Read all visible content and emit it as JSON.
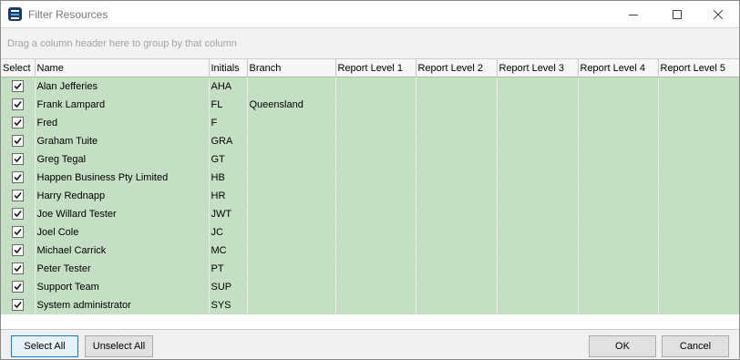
{
  "window": {
    "title": "Filter Resources",
    "icon": "app-logo-icon"
  },
  "group_panel": {
    "hint": "Drag a column header here to group by that column"
  },
  "grid": {
    "columns": [
      "Select",
      "Name",
      "Initials",
      "Branch",
      "Report Level 1",
      "Report Level 2",
      "Report Level 3",
      "Report Level 4",
      "Report Level 5"
    ],
    "rows": [
      {
        "selected": true,
        "name": "Alan Jefferies",
        "initials": "AHA",
        "branch": ""
      },
      {
        "selected": true,
        "name": "Frank Lampard",
        "initials": "FL",
        "branch": "Queensland"
      },
      {
        "selected": true,
        "name": "Fred",
        "initials": "F",
        "branch": ""
      },
      {
        "selected": true,
        "name": "Graham Tuite",
        "initials": "GRA",
        "branch": ""
      },
      {
        "selected": true,
        "name": "Greg Tegal",
        "initials": "GT",
        "branch": ""
      },
      {
        "selected": true,
        "name": "Happen Business Pty Limited",
        "initials": "HB",
        "branch": ""
      },
      {
        "selected": true,
        "name": "Harry Rednapp",
        "initials": "HR",
        "branch": ""
      },
      {
        "selected": true,
        "name": "Joe Willard Tester",
        "initials": "JWT",
        "branch": ""
      },
      {
        "selected": true,
        "name": "Joel Cole",
        "initials": "JC",
        "branch": ""
      },
      {
        "selected": true,
        "name": "Michael Carrick",
        "initials": "MC",
        "branch": ""
      },
      {
        "selected": true,
        "name": "Peter Tester",
        "initials": "PT",
        "branch": ""
      },
      {
        "selected": true,
        "name": "Support Team",
        "initials": "SUP",
        "branch": ""
      },
      {
        "selected": true,
        "name": "System administrator",
        "initials": "SYS",
        "branch": ""
      }
    ],
    "row_color": "#c4dfc4"
  },
  "footer": {
    "select_all_label": "Select All",
    "unselect_all_label": "Unselect All",
    "ok_label": "OK",
    "cancel_label": "Cancel"
  }
}
